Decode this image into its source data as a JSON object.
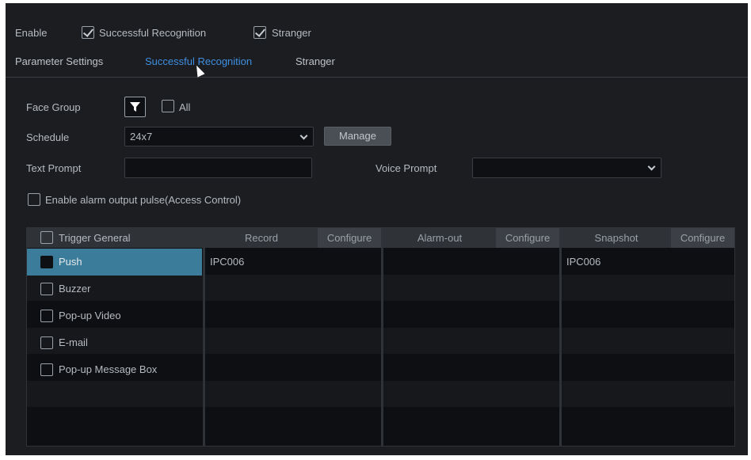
{
  "enable": {
    "label": "Enable",
    "options": [
      {
        "label": "Successful Recognition",
        "checked": true
      },
      {
        "label": "Stranger",
        "checked": true
      }
    ]
  },
  "tabs": [
    {
      "label": "Parameter Settings",
      "active": false
    },
    {
      "label": "Successful Recognition",
      "active": true
    },
    {
      "label": "Stranger",
      "active": false
    }
  ],
  "form": {
    "face_group_label": "Face Group",
    "all_label": "All",
    "all_checked": false,
    "schedule_label": "Schedule",
    "schedule_value": "24x7",
    "manage_label": "Manage",
    "text_prompt_label": "Text Prompt",
    "text_prompt_value": "",
    "voice_prompt_label": "Voice Prompt",
    "voice_prompt_value": "",
    "alarm_pulse_label": "Enable alarm output pulse(Access Control)",
    "alarm_pulse_checked": false
  },
  "grid": {
    "trigger_header": "Trigger General",
    "triggers": [
      {
        "label": "Push",
        "checked": false,
        "selected": true
      },
      {
        "label": "Buzzer",
        "checked": false,
        "selected": false
      },
      {
        "label": "Pop-up Video",
        "checked": false,
        "selected": false
      },
      {
        "label": "E-mail",
        "checked": false,
        "selected": false
      },
      {
        "label": "Pop-up Message Box",
        "checked": false,
        "selected": false
      }
    ],
    "record": {
      "header": "Record",
      "configure": "Configure",
      "items": [
        "IPC006"
      ]
    },
    "alarm_out": {
      "header": "Alarm-out",
      "configure": "Configure",
      "items": []
    },
    "snapshot": {
      "header": "Snapshot",
      "configure": "Configure",
      "items": [
        "IPC006"
      ]
    }
  },
  "colors": {
    "panel_bg": "#1b1d21",
    "accent": "#3f8fe0",
    "selected_row": "#3a7c99"
  }
}
